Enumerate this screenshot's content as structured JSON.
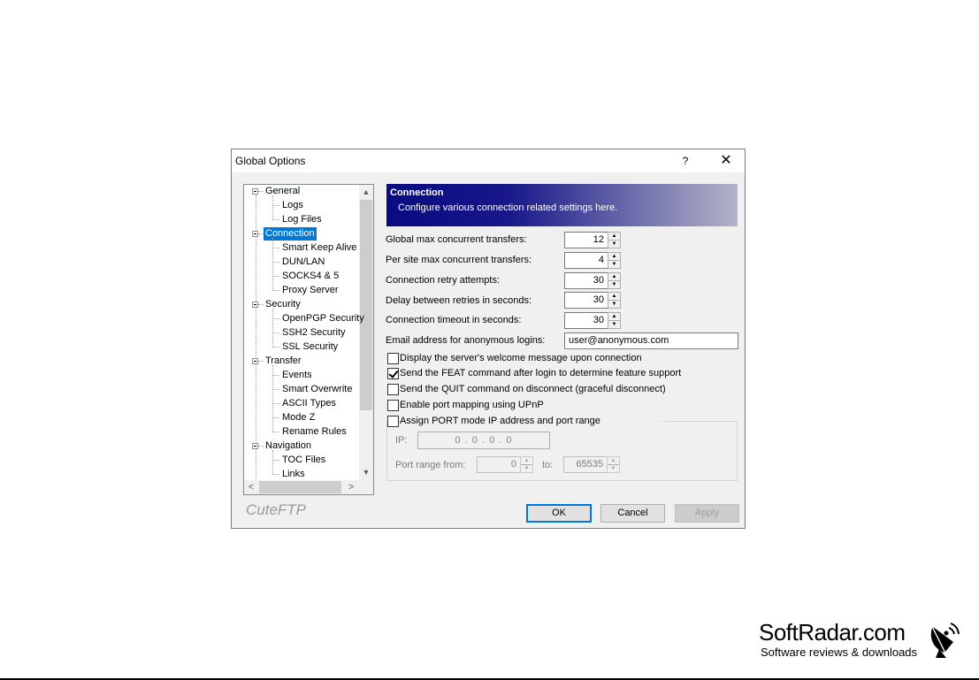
{
  "dialog": {
    "title": "Global Options",
    "help_label": "?",
    "close_label": "✕"
  },
  "tree": {
    "items": [
      {
        "label": "General",
        "level": 0
      },
      {
        "label": "Logs",
        "level": 1
      },
      {
        "label": "Log Files",
        "level": 1
      },
      {
        "label": "Connection",
        "level": 0,
        "selected": true
      },
      {
        "label": "Smart Keep Alive",
        "level": 1
      },
      {
        "label": "DUN/LAN",
        "level": 1
      },
      {
        "label": "SOCKS4 & 5",
        "level": 1
      },
      {
        "label": "Proxy Server",
        "level": 1
      },
      {
        "label": "Security",
        "level": 0
      },
      {
        "label": "OpenPGP Security",
        "level": 1
      },
      {
        "label": "SSH2 Security",
        "level": 1
      },
      {
        "label": "SSL Security",
        "level": 1
      },
      {
        "label": "Transfer",
        "level": 0
      },
      {
        "label": "Events",
        "level": 1
      },
      {
        "label": "Smart Overwrite",
        "level": 1
      },
      {
        "label": "ASCII Types",
        "level": 1
      },
      {
        "label": "Mode Z",
        "level": 1
      },
      {
        "label": "Rename Rules",
        "level": 1
      },
      {
        "label": "Navigation",
        "level": 0
      },
      {
        "label": "TOC Files",
        "level": 1
      },
      {
        "label": "Links",
        "level": 1
      }
    ],
    "scroll_up": "▲",
    "scroll_down": "▼",
    "scroll_left": "<",
    "scroll_right": ">"
  },
  "banner": {
    "title": "Connection",
    "subtitle": "Configure various connection related settings here."
  },
  "settings": {
    "global_max_label": "Global max concurrent transfers:",
    "global_max_value": "12",
    "per_site_label": "Per site max concurrent transfers:",
    "per_site_value": "4",
    "retry_label": "Connection retry attempts:",
    "retry_value": "30",
    "delay_label": "Delay between retries in seconds:",
    "delay_value": "30",
    "timeout_label": "Connection timeout in seconds:",
    "timeout_value": "30",
    "email_label": "Email address for anonymous logins:",
    "email_value": "user@anonymous.com"
  },
  "checkboxes": {
    "welcome": "Display the server's welcome message upon connection",
    "feat": "Send the FEAT command after login to determine feature support",
    "quit": "Send the QUIT command on disconnect (graceful disconnect)",
    "upnp": "Enable port mapping using UPnP",
    "port_mode": "Assign PORT mode IP address and port range"
  },
  "checkbox_states": {
    "welcome": false,
    "feat": true,
    "quit": false,
    "upnp": false,
    "port_mode": false
  },
  "port_group": {
    "ip_label": "IP:",
    "ip_value": "0  .  0  .  0  .  0",
    "range_from_label": "Port range from:",
    "range_from_value": "0",
    "to_label": "to:",
    "to_value": "65535"
  },
  "buttons": {
    "ok": "OK",
    "cancel": "Cancel",
    "apply": "Apply"
  },
  "brand": "CuteFTP",
  "watermark": {
    "title": "SoftRadar.com",
    "subtitle": "Software reviews & downloads"
  }
}
